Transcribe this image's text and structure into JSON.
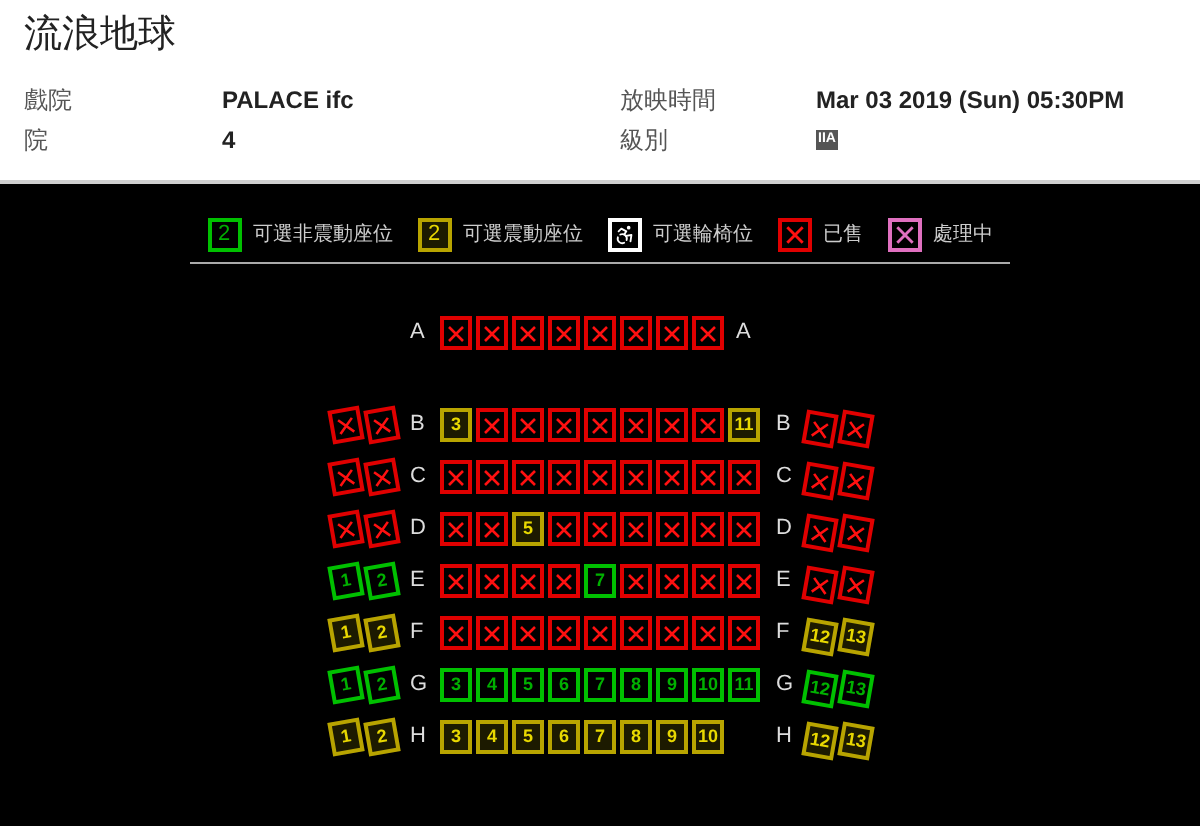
{
  "movie": {
    "title": "流浪地球"
  },
  "details": [
    {
      "label": "戲院",
      "value": "PALACE ifc"
    },
    {
      "label": "放映時間",
      "value": "Mar 03 2019 (Sun) 05:30PM"
    },
    {
      "label": "院",
      "value": "4"
    },
    {
      "label": "級別",
      "value": "IIA",
      "kind": "badge"
    }
  ],
  "legend": [
    {
      "kind": "standard",
      "sample": "2",
      "label": "可選非震動座位"
    },
    {
      "kind": "motion",
      "sample": "2",
      "label": "可選震動座位"
    },
    {
      "kind": "wheelchair",
      "label": "可選輪椅位"
    },
    {
      "kind": "sold",
      "label": "已售"
    },
    {
      "kind": "processing",
      "label": "處理中"
    }
  ],
  "rows": [
    {
      "label_left": "A",
      "label_right": "A",
      "left": [],
      "center": [
        {
          "kind": "sold"
        },
        {
          "kind": "sold"
        },
        {
          "kind": "sold"
        },
        {
          "kind": "sold"
        },
        {
          "kind": "sold"
        },
        {
          "kind": "sold"
        },
        {
          "kind": "sold"
        },
        {
          "kind": "sold"
        }
      ],
      "right": []
    },
    {
      "label_left": "B",
      "label_right": "B",
      "left": [
        {
          "kind": "sold"
        },
        {
          "kind": "sold"
        }
      ],
      "center": [
        {
          "kind": "motion",
          "number": "3"
        },
        {
          "kind": "sold"
        },
        {
          "kind": "sold"
        },
        {
          "kind": "sold"
        },
        {
          "kind": "sold"
        },
        {
          "kind": "sold"
        },
        {
          "kind": "sold"
        },
        {
          "kind": "sold"
        },
        {
          "kind": "motion",
          "number": "11"
        }
      ],
      "right": [
        {
          "kind": "sold"
        },
        {
          "kind": "sold"
        }
      ]
    },
    {
      "label_left": "C",
      "label_right": "C",
      "left": [
        {
          "kind": "sold"
        },
        {
          "kind": "sold"
        }
      ],
      "center": [
        {
          "kind": "sold"
        },
        {
          "kind": "sold"
        },
        {
          "kind": "sold"
        },
        {
          "kind": "sold"
        },
        {
          "kind": "sold"
        },
        {
          "kind": "sold"
        },
        {
          "kind": "sold"
        },
        {
          "kind": "sold"
        },
        {
          "kind": "sold"
        }
      ],
      "right": [
        {
          "kind": "sold"
        },
        {
          "kind": "sold"
        }
      ]
    },
    {
      "label_left": "D",
      "label_right": "D",
      "left": [
        {
          "kind": "sold"
        },
        {
          "kind": "sold"
        }
      ],
      "center": [
        {
          "kind": "sold"
        },
        {
          "kind": "sold"
        },
        {
          "kind": "motion",
          "number": "5"
        },
        {
          "kind": "sold"
        },
        {
          "kind": "sold"
        },
        {
          "kind": "sold"
        },
        {
          "kind": "sold"
        },
        {
          "kind": "sold"
        },
        {
          "kind": "sold"
        }
      ],
      "right": [
        {
          "kind": "sold"
        },
        {
          "kind": "sold"
        }
      ]
    },
    {
      "label_left": "E",
      "label_right": "E",
      "left": [
        {
          "kind": "standard",
          "number": "1"
        },
        {
          "kind": "standard",
          "number": "2"
        }
      ],
      "center": [
        {
          "kind": "sold"
        },
        {
          "kind": "sold"
        },
        {
          "kind": "sold"
        },
        {
          "kind": "sold"
        },
        {
          "kind": "standard",
          "number": "7"
        },
        {
          "kind": "sold"
        },
        {
          "kind": "sold"
        },
        {
          "kind": "sold"
        },
        {
          "kind": "sold"
        }
      ],
      "right": [
        {
          "kind": "sold"
        },
        {
          "kind": "sold"
        }
      ]
    },
    {
      "label_left": "F",
      "label_right": "F",
      "left": [
        {
          "kind": "motion",
          "number": "1"
        },
        {
          "kind": "motion",
          "number": "2"
        }
      ],
      "center": [
        {
          "kind": "sold"
        },
        {
          "kind": "sold"
        },
        {
          "kind": "sold"
        },
        {
          "kind": "sold"
        },
        {
          "kind": "sold"
        },
        {
          "kind": "sold"
        },
        {
          "kind": "sold"
        },
        {
          "kind": "sold"
        },
        {
          "kind": "sold"
        }
      ],
      "right": [
        {
          "kind": "motion",
          "number": "12"
        },
        {
          "kind": "motion",
          "number": "13"
        }
      ]
    },
    {
      "label_left": "G",
      "label_right": "G",
      "left": [
        {
          "kind": "standard",
          "number": "1"
        },
        {
          "kind": "standard",
          "number": "2"
        }
      ],
      "center": [
        {
          "kind": "standard",
          "number": "3"
        },
        {
          "kind": "standard",
          "number": "4"
        },
        {
          "kind": "standard",
          "number": "5"
        },
        {
          "kind": "standard",
          "number": "6"
        },
        {
          "kind": "standard",
          "number": "7"
        },
        {
          "kind": "standard",
          "number": "8"
        },
        {
          "kind": "standard",
          "number": "9"
        },
        {
          "kind": "standard",
          "number": "10"
        },
        {
          "kind": "standard",
          "number": "11"
        }
      ],
      "right": [
        {
          "kind": "standard",
          "number": "12"
        },
        {
          "kind": "standard",
          "number": "13"
        }
      ]
    },
    {
      "label_left": "H",
      "label_right": "H",
      "left": [
        {
          "kind": "motion",
          "number": "1"
        },
        {
          "kind": "motion",
          "number": "2"
        }
      ],
      "center": [
        {
          "kind": "motion",
          "number": "3"
        },
        {
          "kind": "motion",
          "number": "4"
        },
        {
          "kind": "motion",
          "number": "5"
        },
        {
          "kind": "motion",
          "number": "6"
        },
        {
          "kind": "motion",
          "number": "7"
        },
        {
          "kind": "motion",
          "number": "8"
        },
        {
          "kind": "motion",
          "number": "9"
        },
        {
          "kind": "motion",
          "number": "10"
        }
      ],
      "right": [
        {
          "kind": "motion",
          "number": "12"
        },
        {
          "kind": "motion",
          "number": "13"
        }
      ]
    }
  ]
}
